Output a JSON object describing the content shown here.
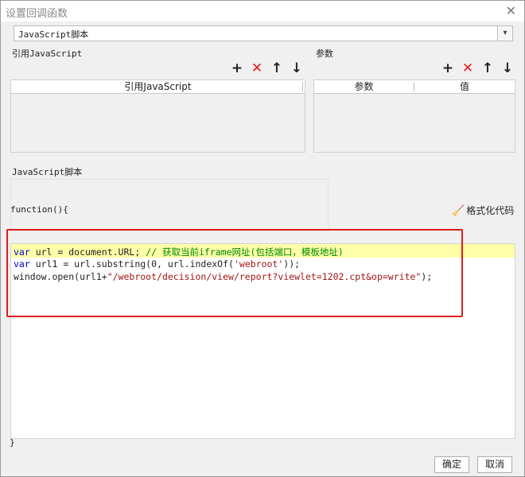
{
  "window": {
    "title": "设置回调函数"
  },
  "script_type": {
    "selected": "JavaScript脚本"
  },
  "ref_js": {
    "label": "引用JavaScript",
    "column": "引用JavaScript"
  },
  "params": {
    "label": "参数",
    "columns": [
      "参数",
      "值"
    ]
  },
  "script": {
    "label": "JavaScript脚本",
    "func_header": "function(){",
    "format_label": "格式化代码",
    "lines": [
      {
        "a": "var",
        "b": " url = document.URL; ",
        "c": "// 获取当前iframe网址(包括端口，模板地址)"
      },
      {
        "a": "var",
        "b": " url1 = url.substring(0, url.indexOf(",
        "c": "'webroot'",
        "d": "));"
      },
      {
        "a": "window.open(url1+",
        "b": "\"/webroot/decision/view/report?viewlet=1202.cpt&op=write\"",
        "c": ");"
      }
    ],
    "func_footer": "}"
  },
  "buttons": {
    "ok": "确定",
    "cancel": "取消"
  }
}
